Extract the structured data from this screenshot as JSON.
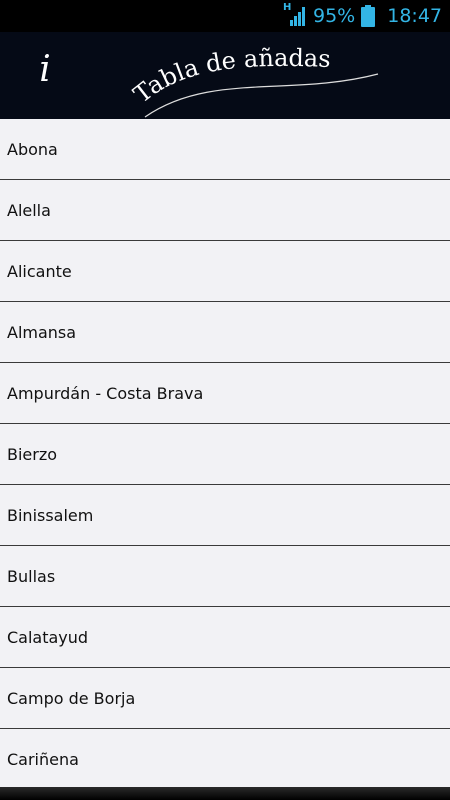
{
  "status_bar": {
    "network_type": "H",
    "battery_percent": "95%",
    "time": "18:47",
    "icons": [
      "signal-icon",
      "battery-icon"
    ],
    "accent_color": "#33b5e5"
  },
  "header": {
    "title": "Tabla de añadas",
    "info_icon_label": "i",
    "background_color": "#050a16"
  },
  "regions": [
    "Abona",
    "Alella",
    "Alicante",
    "Almansa",
    "Ampurdán - Costa Brava",
    "Bierzo",
    "Binissalem",
    "Bullas",
    "Calatayud",
    "Campo de Borja",
    "Cariñena"
  ]
}
